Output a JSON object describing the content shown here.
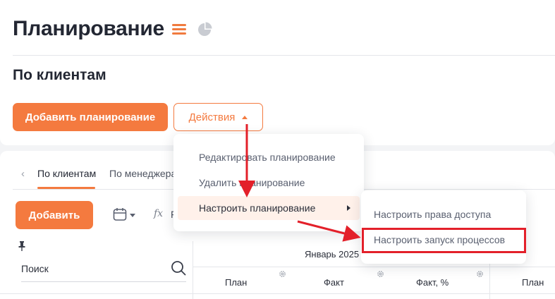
{
  "header": {
    "title": "Планирование",
    "list_view_icon": "list-view-icon",
    "chart_view_icon": "pie-chart-icon"
  },
  "section": {
    "title": "По клиентам"
  },
  "toolbar": {
    "add_plan_label": "Добавить планирование",
    "actions_label": "Действия"
  },
  "actions_menu": {
    "items": [
      {
        "label": "Редактировать планирование"
      },
      {
        "label": "Удалить планирование"
      },
      {
        "label": "Настроить планирование",
        "has_submenu": true
      }
    ]
  },
  "submenu": {
    "items": [
      {
        "label": "Настроить права доступа"
      },
      {
        "label": "Настроить запуск процессов"
      }
    ]
  },
  "tabs": [
    {
      "label": "По клиентам",
      "active": true
    },
    {
      "label": "По менеджера",
      "active": false
    }
  ],
  "table_toolbar": {
    "add_label": "Добавить",
    "fx_symbol": "fx",
    "fx_text": "F"
  },
  "table": {
    "search_label": "Поиск",
    "month": "Январь 2025",
    "columns": [
      "План",
      "Факт",
      "Факт, %",
      "План"
    ]
  },
  "colors": {
    "accent": "#f47a3f",
    "highlight_box": "#e3202a",
    "menu_hover": "#fff1ea"
  }
}
